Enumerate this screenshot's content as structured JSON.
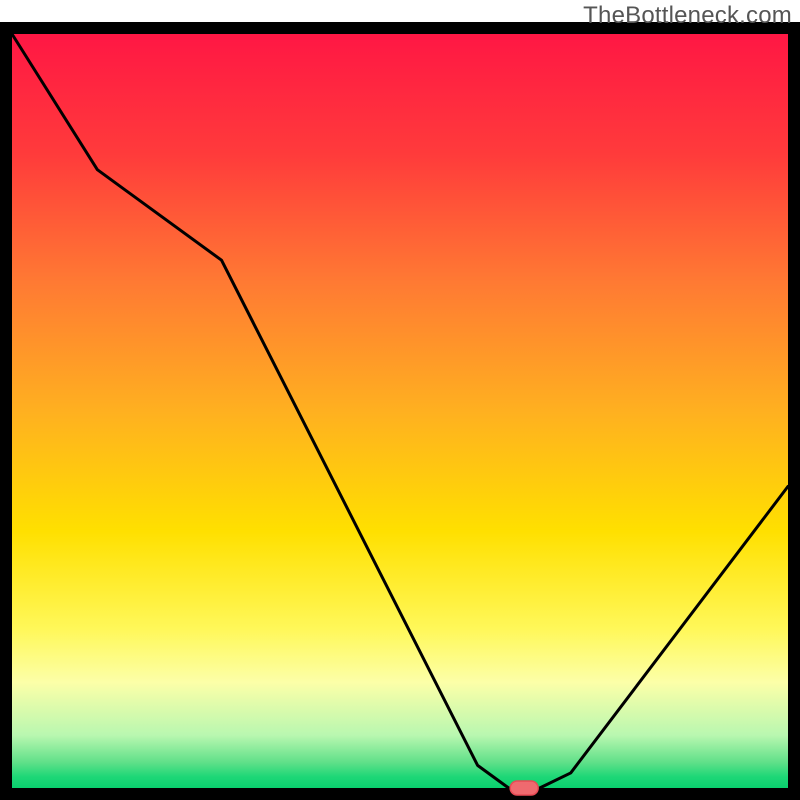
{
  "watermark": "TheBottleneck.com",
  "chart_data": {
    "type": "line",
    "title": "",
    "xlabel": "",
    "ylabel": "",
    "xlim": [
      0,
      100
    ],
    "ylim": [
      0,
      100
    ],
    "x": [
      0,
      11,
      27,
      60,
      64,
      68,
      72,
      100
    ],
    "values": [
      100,
      82,
      70,
      3,
      0,
      0,
      2,
      40
    ],
    "marker": {
      "x": 66,
      "y": 0,
      "color_fill": "#ef6a6f",
      "color_stroke": "#e84a55"
    },
    "gradient_stops": [
      {
        "offset": 0.0,
        "color": "#ff1744"
      },
      {
        "offset": 0.16,
        "color": "#ff3b3b"
      },
      {
        "offset": 0.33,
        "color": "#ff7a33"
      },
      {
        "offset": 0.5,
        "color": "#ffb020"
      },
      {
        "offset": 0.66,
        "color": "#ffe000"
      },
      {
        "offset": 0.79,
        "color": "#fff85a"
      },
      {
        "offset": 0.86,
        "color": "#fcffa8"
      },
      {
        "offset": 0.93,
        "color": "#b9f7b0"
      },
      {
        "offset": 0.966,
        "color": "#60e089"
      },
      {
        "offset": 0.985,
        "color": "#1ed777"
      },
      {
        "offset": 1.0,
        "color": "#0ad06e"
      }
    ],
    "border_color": "#000000",
    "border_width": 12
  }
}
